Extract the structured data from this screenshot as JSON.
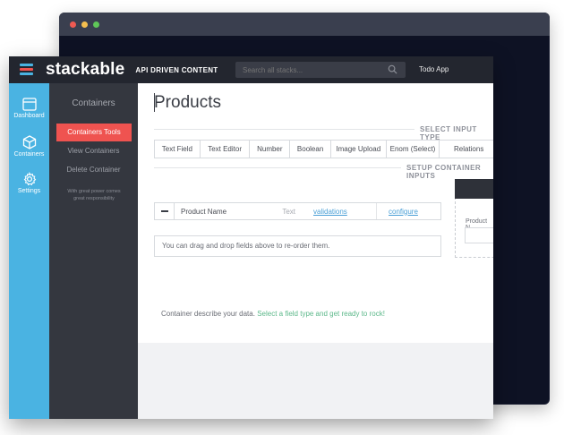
{
  "colors": {
    "nav_blue": "#4ab3e2",
    "accent_red": "#ef5350",
    "link_blue": "#4a9fd6",
    "link_green": "#5cb88a",
    "topbar": "#23262f",
    "subnav": "#34373f",
    "back_window": "#161a2e"
  },
  "back_window": {
    "dots": [
      "#ee5a52",
      "#f5bf4f",
      "#5fc658"
    ]
  },
  "topbar": {
    "brand": "stackable",
    "tagline": "API DRIVEN CONTENT",
    "search_placeholder": "Search all stacks...",
    "search_icon": "search-icon",
    "app_name": "Todo App",
    "logo_colors": [
      "#4ab3e2",
      "#ef5350",
      "#4ab3e2"
    ]
  },
  "nav": {
    "items": [
      {
        "label": "Dashboard",
        "icon": "dashboard-icon"
      },
      {
        "label": "Containers",
        "icon": "cube-icon"
      },
      {
        "label": "Settings",
        "icon": "gear-icon"
      }
    ]
  },
  "subnav": {
    "title": "Containers",
    "active": "Containers Tools",
    "links": [
      "View Containers",
      "Delete Container"
    ],
    "note": "With great power comes great responsibility"
  },
  "main": {
    "title": "Products",
    "select_input_label": "SELECT INPUT TYPE",
    "setup_inputs_label": "SETUP CONTAINER INPUTS",
    "input_types": [
      "Text Field",
      "Text Editor",
      "Number",
      "Boolean",
      "Image Upload",
      "Enom (Select)",
      "Relations"
    ],
    "field": {
      "name": "Product Name",
      "type": "Text",
      "validations": "validations",
      "configure": "configure"
    },
    "drop_hint": "You can drag and drop fields above to re-order them.",
    "describe_prefix": "Container describe your data.",
    "describe_link": "Select a field type and get ready to rock!",
    "preview_label": "Product N"
  }
}
